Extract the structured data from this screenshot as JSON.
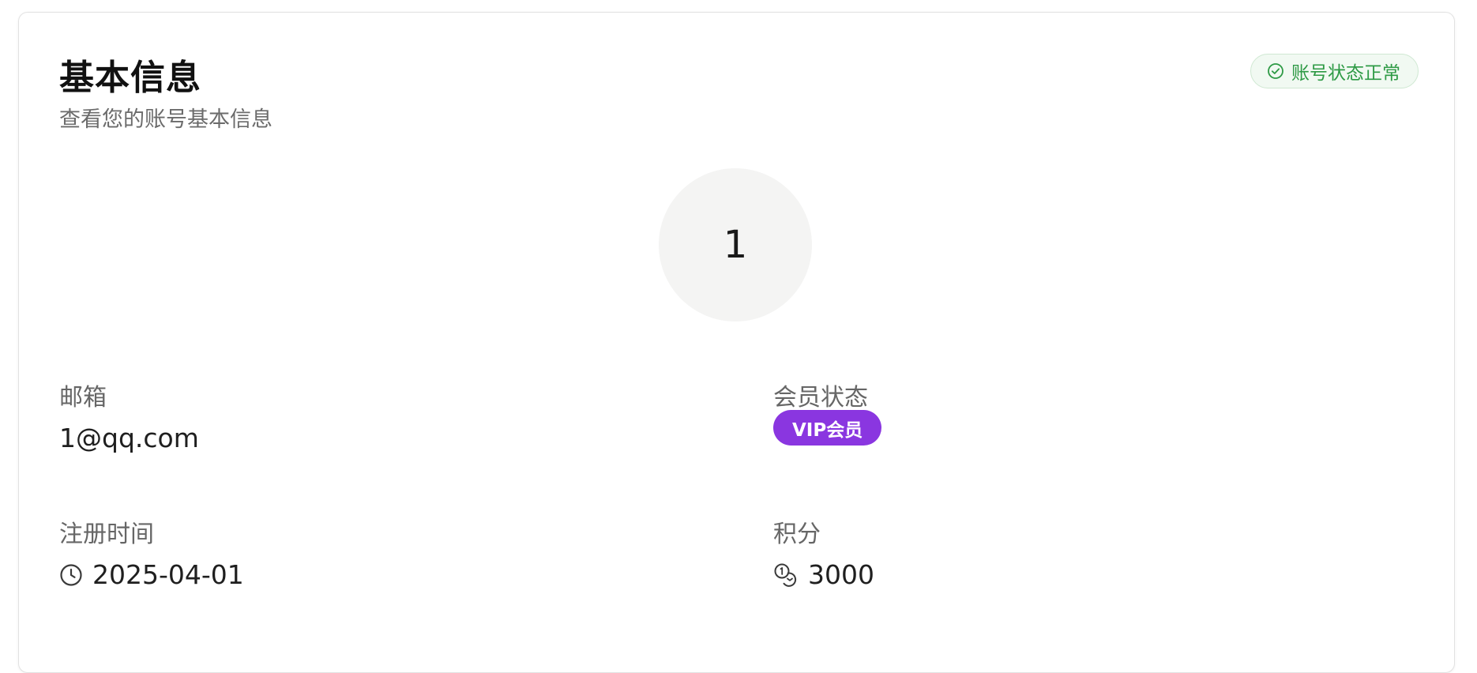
{
  "card": {
    "title": "基本信息",
    "subtitle": "查看您的账号基本信息",
    "status_badge": {
      "label": "账号状态正常",
      "icon": "check-circle-icon",
      "color": "#2e9a45"
    }
  },
  "avatar": {
    "text": "1"
  },
  "fields": {
    "email": {
      "label": "邮箱",
      "value": "1@qq.com"
    },
    "membership": {
      "label": "会员状态",
      "badge": "VIP会员",
      "badge_color": "#8a36e0"
    },
    "registered": {
      "label": "注册时间",
      "value": "2025-04-01",
      "icon": "clock-icon"
    },
    "points": {
      "label": "积分",
      "value": "3000",
      "icon": "coins-icon"
    }
  }
}
